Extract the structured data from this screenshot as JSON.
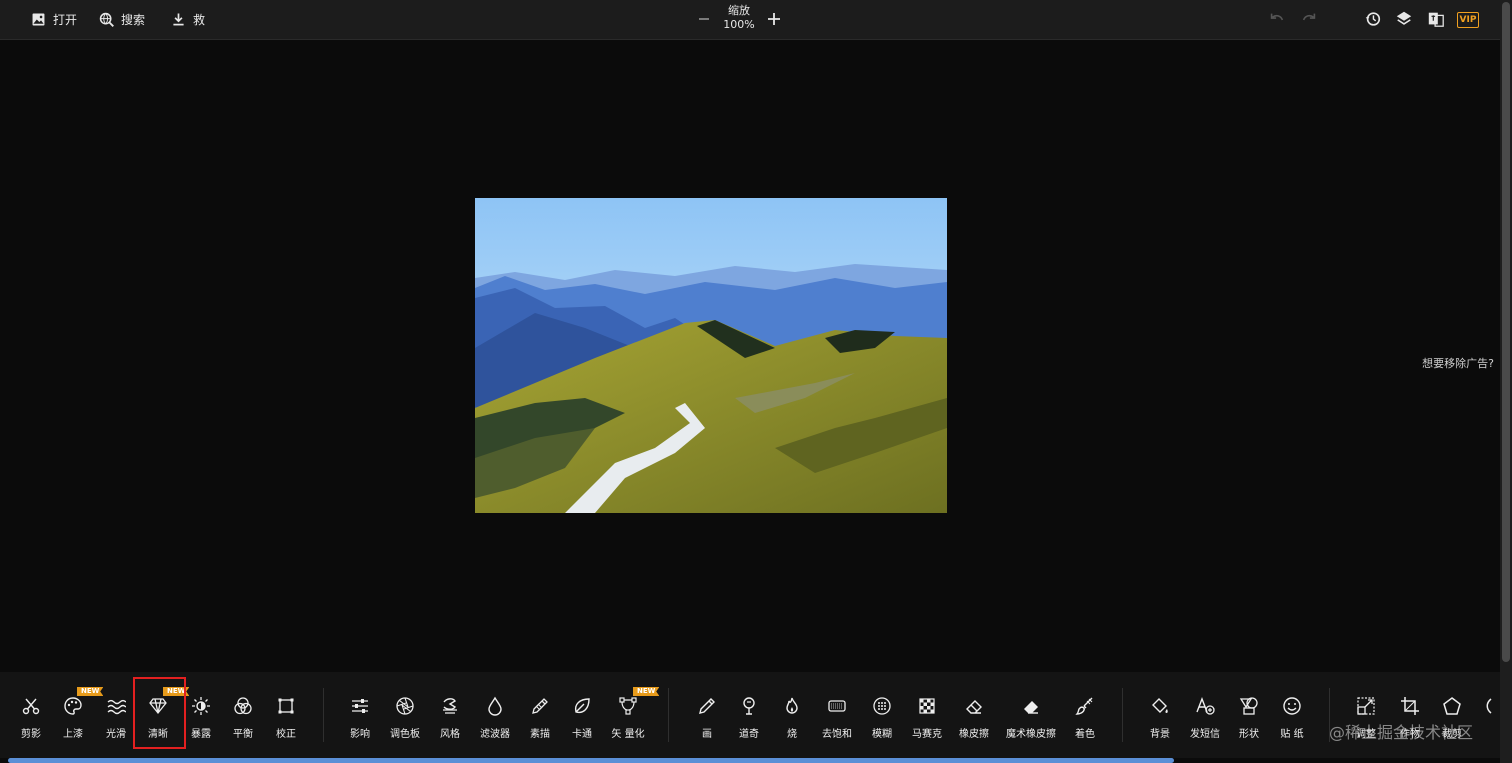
{
  "topbar": {
    "open_label": "打开",
    "search_label": "搜索",
    "save_label": "救",
    "zoom_title": "缩放",
    "zoom_value": "100%"
  },
  "ad_text": "想要移除广告?",
  "tools": {
    "group1": [
      "剪影",
      "上漆",
      "光滑",
      "清晰",
      "暴露",
      "平衡",
      "校正"
    ],
    "group2": [
      "影响",
      "调色板",
      "风格",
      "滤波器",
      "素描",
      "卡通",
      "矢 量化"
    ],
    "group3": [
      "画",
      "道奇",
      "烧",
      "去饱和",
      "模糊",
      "马赛克",
      "橡皮擦",
      "魔术橡皮擦",
      "着色"
    ],
    "group4": [
      "背景",
      "发短信",
      "形状",
      "贴 纸"
    ],
    "group5": [
      "调整",
      "作物",
      "裁剪"
    ]
  },
  "new_tag": "NEW",
  "vip": "VIP",
  "watermark": "@稀土掘金技术社区",
  "colors": {
    "accent_orange": "#e79b1b",
    "highlight_red": "#e32020",
    "progress_blue": "#5b8fd6"
  }
}
